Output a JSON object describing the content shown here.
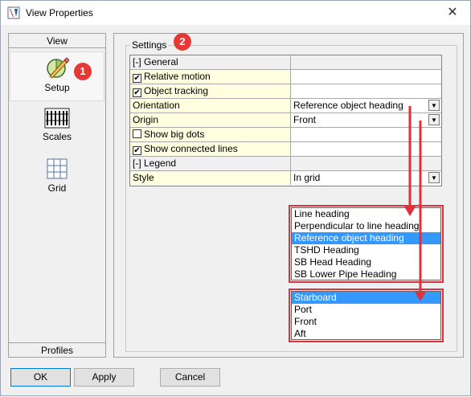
{
  "window": {
    "title": "View Properties",
    "close_glyph": "✕"
  },
  "left_panel": {
    "header": "View",
    "footer": "Profiles",
    "items": [
      {
        "label": "Setup",
        "icon": "setup-icon",
        "selected": true
      },
      {
        "label": "Scales",
        "icon": "scales-icon",
        "selected": false
      },
      {
        "label": "Grid",
        "icon": "grid-icon",
        "selected": false
      }
    ]
  },
  "badges": {
    "one": "1",
    "two": "2"
  },
  "settings": {
    "group_label": "Settings",
    "rows": [
      {
        "name": "[-] General",
        "value": "",
        "type": "section"
      },
      {
        "name": "Relative motion",
        "checked": true,
        "value": "",
        "type": "checkbox"
      },
      {
        "name": "Object tracking",
        "checked": true,
        "value": "",
        "type": "checkbox"
      },
      {
        "name": "Orientation",
        "value": "Reference object heading",
        "type": "dropdown"
      },
      {
        "name": "Origin",
        "value": "Front",
        "type": "dropdown"
      },
      {
        "name": "Show big dots",
        "checked": false,
        "value": "",
        "type": "checkbox"
      },
      {
        "name": "Show connected lines",
        "checked": true,
        "value": "",
        "type": "checkbox"
      },
      {
        "name": "[-] Legend",
        "value": "",
        "type": "section"
      },
      {
        "name": "Style",
        "value": "In grid",
        "type": "dropdown"
      }
    ],
    "check_glyph": "✔",
    "dropdown_glyph": "▼"
  },
  "orientation_options": {
    "items": [
      "Line heading",
      "Perpendicular to line heading",
      "Reference object heading",
      "TSHD Heading",
      "SB Head Heading",
      "SB Lower Pipe Heading"
    ],
    "selected_index": 2
  },
  "origin_options": {
    "items": [
      "Starboard",
      "Port",
      "Front",
      "Aft"
    ],
    "selected_index": 0
  },
  "buttons": {
    "ok": "OK",
    "apply": "Apply",
    "cancel": "Cancel"
  },
  "colors": {
    "highlight": "#3399ff",
    "annotation_red": "#e0303a",
    "property_name_bg": "#ffffe0"
  }
}
